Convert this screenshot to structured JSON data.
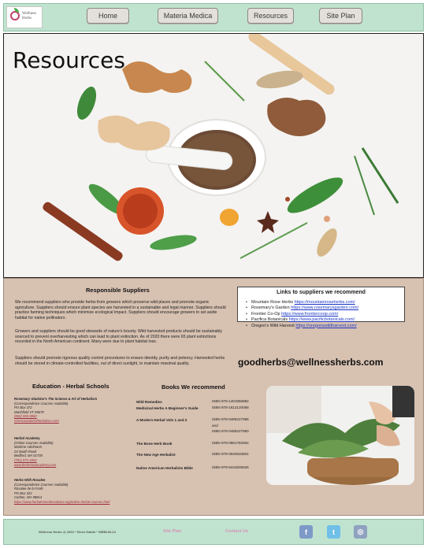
{
  "brand": {
    "logo_line1": "Wellness",
    "logo_line2": "Herbs"
  },
  "nav": [
    {
      "label": "Home"
    },
    {
      "label": "Materia Medica"
    },
    {
      "label": "Resources"
    },
    {
      "label": "Site Plan"
    }
  ],
  "hero": {
    "title": "Resources"
  },
  "suppliers": {
    "heading": "Responsible Suppliers",
    "p1": "We recommend suppliers who provide herbs from growers which preserve wild places and promote organic agriculture. Suppliers should ensure plant species are harvested in a sustainable and legal manner. Suppliers should practice farming techniques which minimize ecological impact. Suppliers should encourage growers to set aside habitat for native pollinators.",
    "p2": "Growers and suppliers should be good stewards of nature's bounty. Wild harvested products should be sustainably sourced to prevent overharvesting which can lead to plant extinction. As of 2020 there were 65 plant extinctions recorded in the North American continent. Many were due to plant habitat loss.",
    "p3": "Suppliers should promote rigorous quality control procedures to ensure identity, purity and potency. Harvested herbs should be stored in climate-controlled facilities, out of direct sunlight, to maintain maximal quality."
  },
  "links": {
    "heading": "Links to suppliers we recommend",
    "items": [
      {
        "name": "Mountain Rose Herbs",
        "url": "https://mountainroseherbs.com/"
      },
      {
        "name": "Rosemary's Garden",
        "url": "https://www.rosemarysgarden.com/"
      },
      {
        "name": "Frontier Co-Op",
        "url": "https://www.frontiercoop.com/"
      },
      {
        "name": "Pacifica Botanicals",
        "url": "https://www.pacificbotanicals.com/"
      },
      {
        "name": "Oregon's Wild Harvest",
        "url": "https://oregonswildharvest.com/"
      }
    ]
  },
  "email": "goodherbs@wellnessherbs.com",
  "education": {
    "heading": "Education - Herbal Schools",
    "schools": [
      {
        "name": "Rosemary Gladstar's The Science & Art of Herbalism",
        "lines": [
          "(Correspondence Courses Available)",
          "PO Box 372",
          "Washfield VT 05679",
          "(802) 555-0860"
        ],
        "web": "scienceandartofherbalism.com"
      },
      {
        "name": "Herbal Academy",
        "lines": [
          "(Online Courses Available)",
          "Marlene Adelmann",
          "24 South Road",
          "Bedford, MA 01730",
          "(781) 572-4454"
        ],
        "web": "www.theherbalacademy.com"
      },
      {
        "name": "Herbs With Rosalee",
        "lines": [
          "(Correspondence Courses Available)",
          "Rosalee de la Forêt",
          "PO Box 322",
          "Carlton, WA 98814"
        ],
        "web": "https://www.herbalremediesadvice.org/online-herbal-courses.html"
      }
    ]
  },
  "books": {
    "heading": "Books We recommend",
    "items": [
      {
        "title": "Wild Remedies",
        "isbn": [
          "ISBN 978-1401956882"
        ]
      },
      {
        "title": "Medicinal Herbs A Beginner's Guide",
        "isbn": [
          "ISBN 978-1612120058"
        ]
      },
      {
        "title": "A Modern Herbal Vols 1 and 2",
        "isbn": [
          "ISBN 978-0486227986",
          "and",
          "ISBN 978-0486227993"
        ]
      },
      {
        "title": "The Bone Herb Book",
        "isbn": [
          "ISBN 978-0961782504"
        ]
      },
      {
        "title": "The New Age Herbalist",
        "isbn": [
          "ISBN 978-0020633501"
        ]
      },
      {
        "title": "Native American Herbalists Bible",
        "isbn": [
          "ISBN 979-8444505526"
        ]
      }
    ]
  },
  "footer": {
    "copyright": "Wellness Herbs @ 2023 * Steve Daklin * WEB130-14",
    "site_plan": "Site Plan",
    "contact": "Contact Us",
    "social": [
      {
        "icon": "facebook-icon",
        "glyph": "f",
        "color": "#7d99c8"
      },
      {
        "icon": "twitter-icon",
        "glyph": "t",
        "color": "#6fbfe8"
      },
      {
        "icon": "instagram-icon",
        "glyph": "◎",
        "color": "#8fa1bf"
      }
    ]
  }
}
